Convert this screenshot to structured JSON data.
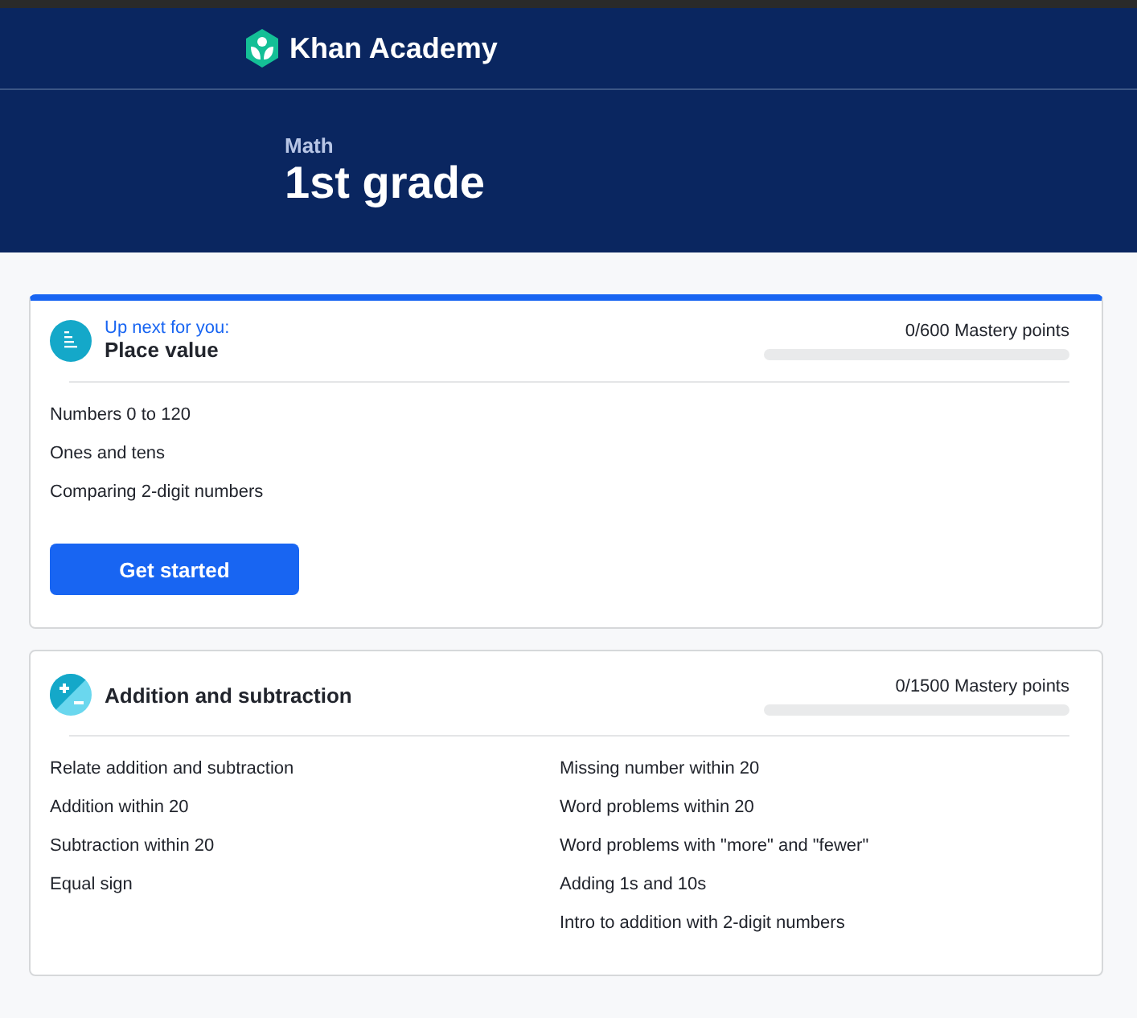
{
  "header": {
    "logo_text": "Khan Academy",
    "subject": "Math",
    "title": "1st grade"
  },
  "units": [
    {
      "highlighted": true,
      "eyebrow": "Up next for you:",
      "kind": "place_value",
      "title": "Place value",
      "mastery": "0/600 Mastery points",
      "level": 0,
      "columns": [
        [
          "Numbers 0 to 120",
          "Ones and tens",
          "Comparing 2-digit numbers"
        ]
      ],
      "button": "Get started"
    },
    {
      "highlighted": false,
      "kind": "arithmetic",
      "title": "Addition and subtraction",
      "mastery": "0/1500 Mastery points",
      "level": 0,
      "columns": [
        [
          "Relate addition and subtraction",
          "Addition within 20",
          "Subtraction within 20",
          "Equal sign"
        ],
        [
          "Missing number within 20",
          "Word problems within 20",
          "Word problems with \"more\" and \"fewer\"",
          "Adding 1s and 10s",
          "Intro to addition with 2-digit numbers"
        ]
      ]
    }
  ]
}
